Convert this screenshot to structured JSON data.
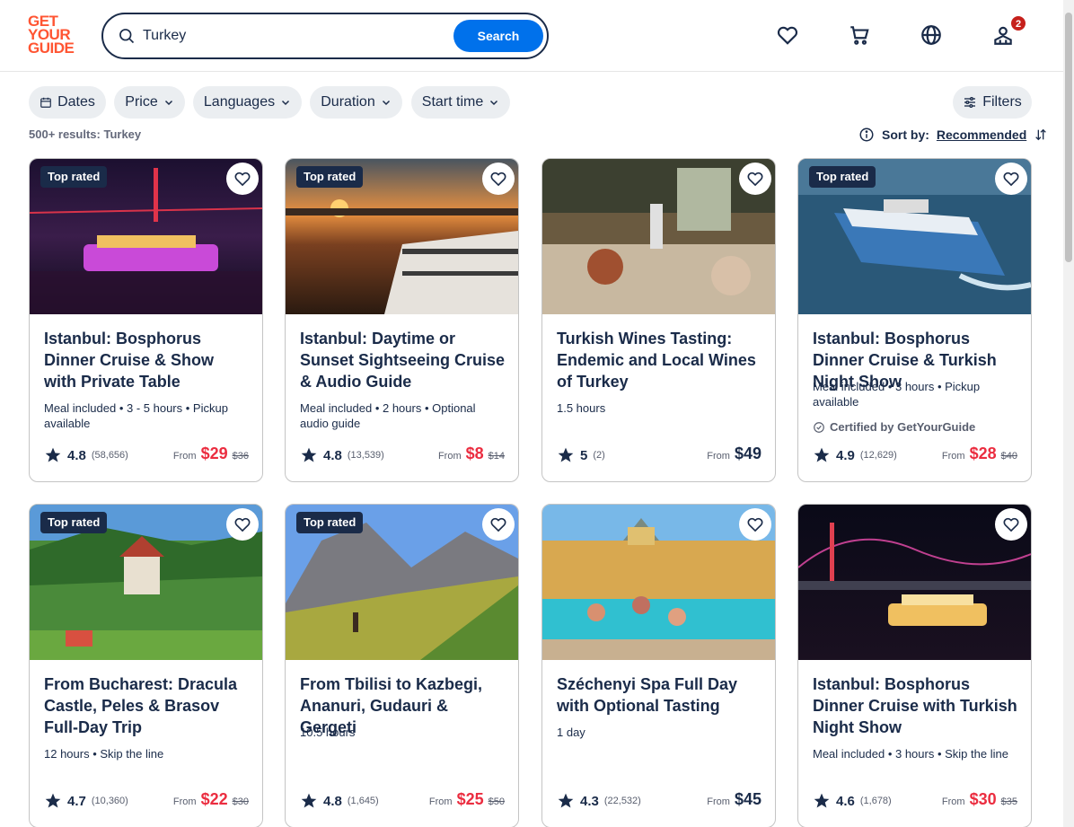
{
  "header": {
    "logo_lines": [
      "GET",
      "YOUR",
      "GUIDE"
    ],
    "search_value": "Turkey",
    "search_button": "Search",
    "cart_badge": "2",
    "icons": [
      "heart-icon",
      "cart-icon",
      "globe-icon",
      "profile-icon"
    ]
  },
  "filters": {
    "chips": [
      "Dates",
      "Price",
      "Languages",
      "Duration",
      "Start time"
    ],
    "filters_button": "Filters",
    "results_text": "500+ results: Turkey",
    "sort_label": "Sort by:",
    "sort_value": "Recommended"
  },
  "colors": {
    "accent": "#0071eb",
    "brand": "#ff5533",
    "sale": "#eb2d40",
    "text": "#1a2b49"
  },
  "cards": [
    {
      "top_rated": "Top rated",
      "title": "Istanbul: Bosphorus Dinner Cruise & Show with Private Table",
      "meta": "Meal included • 3 - 5 hours • Pickup available",
      "rating": "4.8",
      "reviews": "(58,656)",
      "from": "From",
      "price": "$29",
      "old_price": "$36"
    },
    {
      "top_rated": "Top rated",
      "title": "Istanbul: Daytime or Sunset Sightseeing Cruise & Audio Guide",
      "meta": "Meal included • 2 hours • Optional audio guide",
      "rating": "4.8",
      "reviews": "(13,539)",
      "from": "From",
      "price": "$8",
      "old_price": "$14"
    },
    {
      "top_rated": "",
      "title": "Turkish Wines Tasting: Endemic and Local Wines of Turkey",
      "meta": "1.5 hours",
      "rating": "5",
      "reviews": "(2)",
      "from": "From",
      "price": "$49",
      "old_price": ""
    },
    {
      "top_rated": "Top rated",
      "title": "Istanbul: Bosphorus Dinner Cruise & Turkish Night Show",
      "meta": "Meal included • 3 hours • Pickup available",
      "certified": "Certified by GetYourGuide",
      "rating": "4.9",
      "reviews": "(12,629)",
      "from": "From",
      "price": "$28",
      "old_price": "$40"
    },
    {
      "top_rated": "Top rated",
      "title": "From Bucharest: Dracula Castle, Peles & Brasov Full-Day Trip",
      "meta": "12 hours • Skip the line",
      "rating": "4.7",
      "reviews": "(10,360)",
      "from": "From",
      "price": "$22",
      "old_price": "$30"
    },
    {
      "top_rated": "Top rated",
      "title": "From Tbilisi to Kazbegi, Ananuri, Gudauri & Gergeti",
      "meta": "10.5 hours",
      "rating": "4.8",
      "reviews": "(1,645)",
      "from": "From",
      "price": "$25",
      "old_price": "$50"
    },
    {
      "top_rated": "",
      "title": "Széchenyi Spa Full Day with Optional Tasting",
      "meta": "1 day",
      "rating": "4.3",
      "reviews": "(22,532)",
      "from": "From",
      "price": "$45",
      "old_price": ""
    },
    {
      "top_rated": "",
      "title": "Istanbul: Bosphorus Dinner Cruise with Turkish Night Show",
      "meta": "Meal included • 3 hours • Skip the line",
      "rating": "4.6",
      "reviews": "(1,678)",
      "from": "From",
      "price": "$30",
      "old_price": "$35"
    }
  ]
}
